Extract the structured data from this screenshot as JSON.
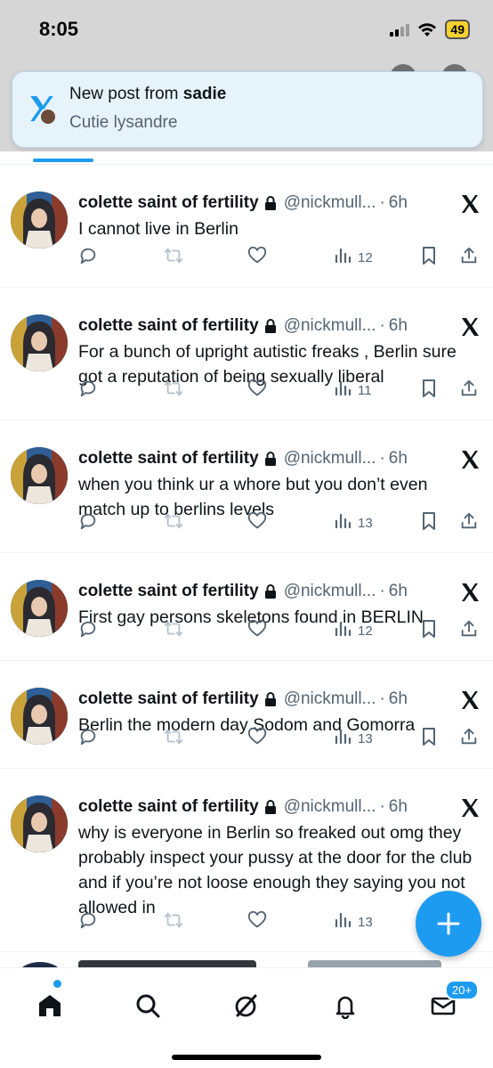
{
  "status_bar": {
    "time": "8:05",
    "battery": "49"
  },
  "banner": {
    "prefix": "New post from ",
    "author": "sadie",
    "text": "Cutie lysandre"
  },
  "tweets": [
    {
      "name": "colette saint of fertility",
      "handle": "@nickmull...",
      "sep": "·",
      "time": "6h",
      "text": "I cannot live in Berlin",
      "views": "12"
    },
    {
      "name": "colette saint of fertility",
      "handle": "@nickmull...",
      "sep": "·",
      "time": "6h",
      "text": "For a bunch of upright autistic freaks , Berlin sure got a reputation of being sexually liberal",
      "views": "11"
    },
    {
      "name": "colette saint of fertility",
      "handle": "@nickmull...",
      "sep": "·",
      "time": "6h",
      "text": "when you think ur a whore but you don’t even match up to berlins levels",
      "views": "13"
    },
    {
      "name": "colette saint of fertility",
      "handle": "@nickmull...",
      "sep": "·",
      "time": "6h",
      "text": "First gay persons skeletons found in BERLIN",
      "views": "12"
    },
    {
      "name": "colette saint of fertility",
      "handle": "@nickmull...",
      "sep": "·",
      "time": "6h",
      "text": "Berlin the modern day Sodom and Gomorra",
      "views": "13"
    },
    {
      "name": "colette saint of fertility",
      "handle": "@nickmull...",
      "sep": "·",
      "time": "6h",
      "text": "why is everyone in Berlin so freaked out omg they probably inspect your pussy at the door for the club and if you’re not loose enough they saying you not allowed in",
      "views": "13"
    }
  ],
  "nav": {
    "messages_badge": "20+",
    "icons": [
      "home-icon",
      "search-icon",
      "grok-icon",
      "bell-icon",
      "mail-icon"
    ]
  },
  "colors": {
    "accent": "#1d9bf0",
    "secondary_text": "#536471"
  }
}
